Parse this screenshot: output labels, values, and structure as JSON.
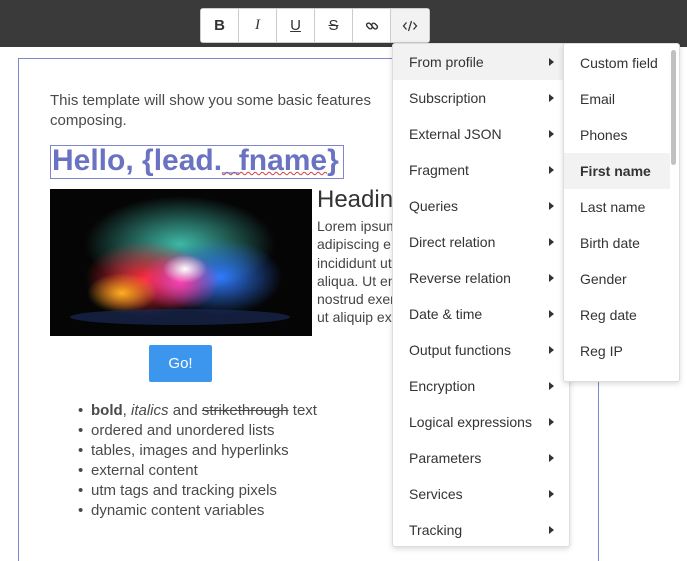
{
  "toolbar": {
    "buttons": [
      {
        "label": "B"
      },
      {
        "label": "I"
      },
      {
        "label": "U"
      },
      {
        "label": "S"
      },
      {
        "icon": "link-icon"
      },
      {
        "icon": "code-icon"
      }
    ]
  },
  "editor": {
    "intro": "This template will show you some basic features composing.",
    "greeting_prefix": "Hello, {lead.",
    "greeting_var": "_fname",
    "greeting_suffix": "}",
    "heading": "Headin",
    "lorem_lines": [
      "Lorem ipsum",
      "adipiscing e",
      "incididunt ut",
      "aliqua. Ut en",
      "nostrud exer",
      "ut aliquip ex"
    ],
    "button_label": "Go!",
    "features": {
      "bold": "bold",
      "comma": ",",
      "italics": "italics",
      "and": "and",
      "strike": "strikethrough",
      "text": "text",
      "items": [
        "ordered and unordered lists",
        "tables, images and hyperlinks",
        "external content",
        "utm tags and tracking pixels",
        "dynamic content variables"
      ]
    }
  },
  "menu": {
    "items": [
      "From profile",
      "Subscription",
      "External JSON",
      "Fragment",
      "Queries",
      "Direct relation",
      "Reverse relation",
      "Date & time",
      "Output functions",
      "Encryption",
      "Logical expressions",
      "Parameters",
      "Services",
      "Tracking"
    ],
    "highlighted": "From profile"
  },
  "submenu": {
    "items": [
      "Custom field",
      "Email",
      "Phones",
      "First name",
      "Last name",
      "Birth date",
      "Gender",
      "Reg date",
      "Reg IP"
    ],
    "highlighted": "First name"
  },
  "colors": {
    "topbar": "#3a3a3a",
    "accent": "#6a72c2",
    "button": "#3d96ee"
  }
}
